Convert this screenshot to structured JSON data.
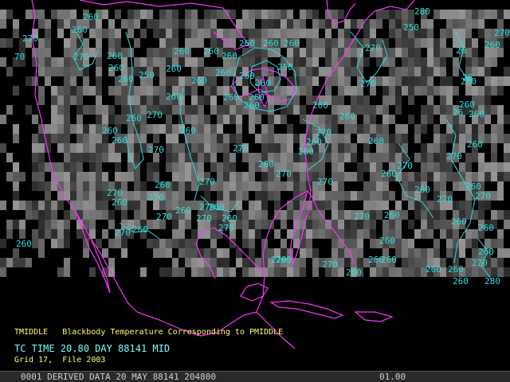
{
  "product": {
    "title_line": "TMIDDLE   Blackbody Temperature Corresponding to PMIDDLE",
    "time_line": "TC TIME 20.80 DAY 88141 MID",
    "grid_line": "Grid 17,  File 2003"
  },
  "status_bar": {
    "text": "0001 DERIVED DATA 20 MAY 88141 204800",
    "value": "01.00"
  },
  "colors": {
    "background": "#000000",
    "coastline": "#ff33ff",
    "contours": "#33dddd",
    "caption": "#ffff66",
    "time_caption": "#77ffff"
  },
  "contour_labels": [
    "260",
    "270",
    "260",
    "70",
    "270",
    "260",
    "260",
    "260",
    "250",
    "260",
    "260",
    "260",
    "260",
    "260",
    "260",
    "260",
    "270",
    "260",
    "260",
    "270",
    "260",
    "260",
    "260",
    "260",
    "260",
    "260",
    "250",
    "260",
    "260",
    "260",
    "270",
    "260",
    "260",
    "270",
    "260",
    "260",
    "270",
    "260",
    "270",
    "270",
    "270",
    "260",
    "270",
    "260",
    "260",
    "270",
    "270",
    "260",
    "260",
    "270",
    "260",
    "270",
    "260",
    "270",
    "260",
    "270",
    "260",
    "260",
    "260",
    "260",
    "270",
    "260",
    "260",
    "270",
    "260",
    "260",
    "270",
    "260",
    "270",
    "260",
    "260",
    "260",
    "260",
    "280",
    "270",
    "260",
    "260",
    "260",
    "270",
    "26",
    "26",
    "260",
    "260",
    "26",
    "270",
    "260",
    "270",
    "260",
    "260",
    "250",
    "270",
    "280",
    "270"
  ]
}
